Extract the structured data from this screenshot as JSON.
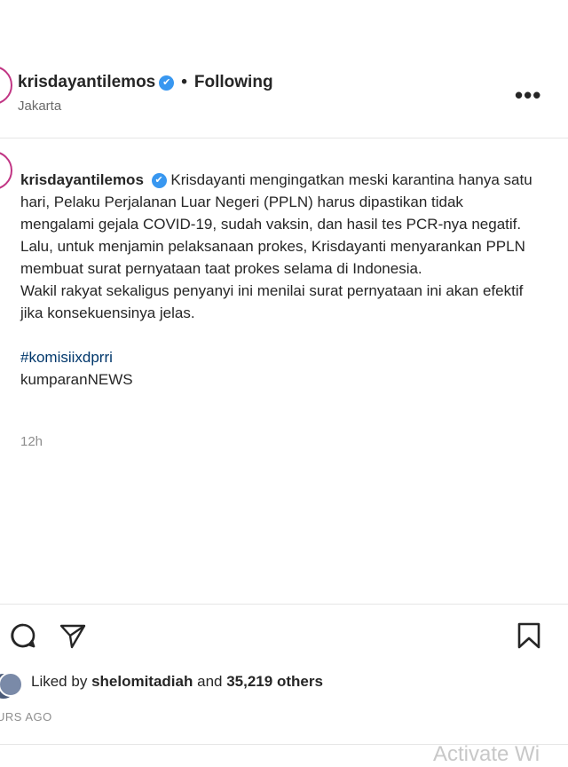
{
  "header": {
    "username": "krisdayantilemos",
    "verified_mark": "✔",
    "separator": "•",
    "follow_status": "Following",
    "location": "Jakarta",
    "more_icon": "more-options-icon"
  },
  "caption": {
    "username": "krisdayantilemos",
    "line1": "Krisdayanti mengingatkan meski karantina hanya satu hari, Pelaku Perjalanan Luar Negeri (PPLN) harus dipastikan tidak mengalami gejala COVID-19, sudah vaksin, dan hasil tes PCR-nya negatif. Lalu, untuk menjamin pelaksanaan prokes, Krisdayanti menyarankan PPLN membuat surat pernyataan taat prokes selama di Indonesia.",
    "line2": "Wakil rakyat sekaligus penyanyi ini menilai surat pernyataan ini akan efektif jika konsekuensinya jelas.",
    "hashtag": "#komisiixdprri",
    "signature": "kumparanNEWS",
    "time": "12h"
  },
  "actions": {
    "icons": [
      "comment-icon",
      "share-icon",
      "bookmark-icon"
    ]
  },
  "likes": {
    "prefix": "Liked by",
    "user": "shelomitadiah",
    "conjunction": "and",
    "count": "35,219 others",
    "posted_ago": "URS AGO"
  },
  "overlay": {
    "watermark": "Activate Wi"
  },
  "colors": {
    "verified": "#3897f0",
    "hashtag": "#00376b",
    "ring": "#c13584"
  }
}
